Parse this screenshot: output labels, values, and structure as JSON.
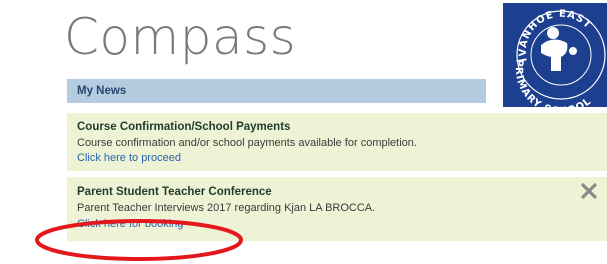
{
  "brand": {
    "name": "Compass"
  },
  "school_logo": {
    "text": "IVANHOE EAST PRIMARY SCHOOL",
    "colors": {
      "background": "#1d3f8f",
      "figure": "#ffffff"
    }
  },
  "news": {
    "header": "My News",
    "items": [
      {
        "title": "Course Confirmation/School Payments",
        "body": "Course confirmation and/or school payments available for completion.",
        "link": "Click here to proceed"
      },
      {
        "title": "Parent Student Teacher Conference",
        "body": "Parent Teacher Interviews 2017 regarding Kjan LA BROCCA.",
        "link": "Click here for booking",
        "dismiss_icon": "close-icon"
      }
    ]
  },
  "annotation": {
    "shape": "ellipse",
    "color": "#e3171c",
    "target": "booking link"
  }
}
